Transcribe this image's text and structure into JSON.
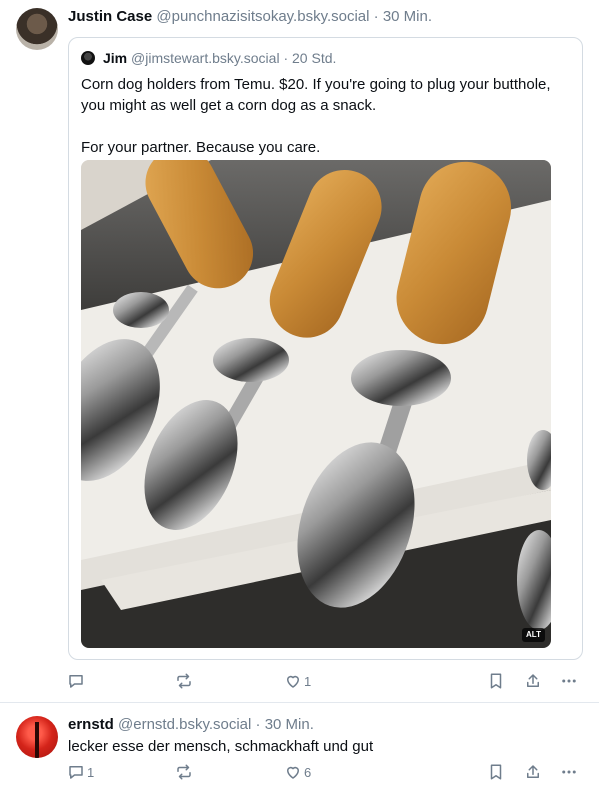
{
  "posts": [
    {
      "author_name": "Justin Case",
      "author_handle": "@punchnazisitsokay.bsky.social",
      "time": "30 Min.",
      "quote": {
        "author_name": "Jim",
        "author_handle": "@jimstewart.bsky.social",
        "time": "20 Std.",
        "text_line1": "Corn dog holders from Temu. $20. If you're going to plug your butthole, you might as well get a corn dog as a snack.",
        "text_line2": "For your partner. Because you care.",
        "image_badge": "ALT"
      },
      "actions": {
        "reply_count": "",
        "repost_count": "",
        "like_count": "1"
      }
    },
    {
      "author_name": "ernstd",
      "author_handle": "@ernstd.bsky.social",
      "time": "30 Min.",
      "text": "lecker esse der mensch, schmackhaft und gut",
      "actions": {
        "reply_count": "1",
        "repost_count": "",
        "like_count": "6"
      }
    }
  ],
  "separator": "·",
  "icons": [
    "reply-icon",
    "repost-icon",
    "like-icon",
    "bookmark-icon",
    "share-icon",
    "more-icon"
  ],
  "colors": {
    "text": "#0b0f14",
    "muted": "#6f7d8c",
    "border": "#d4dbe2"
  }
}
